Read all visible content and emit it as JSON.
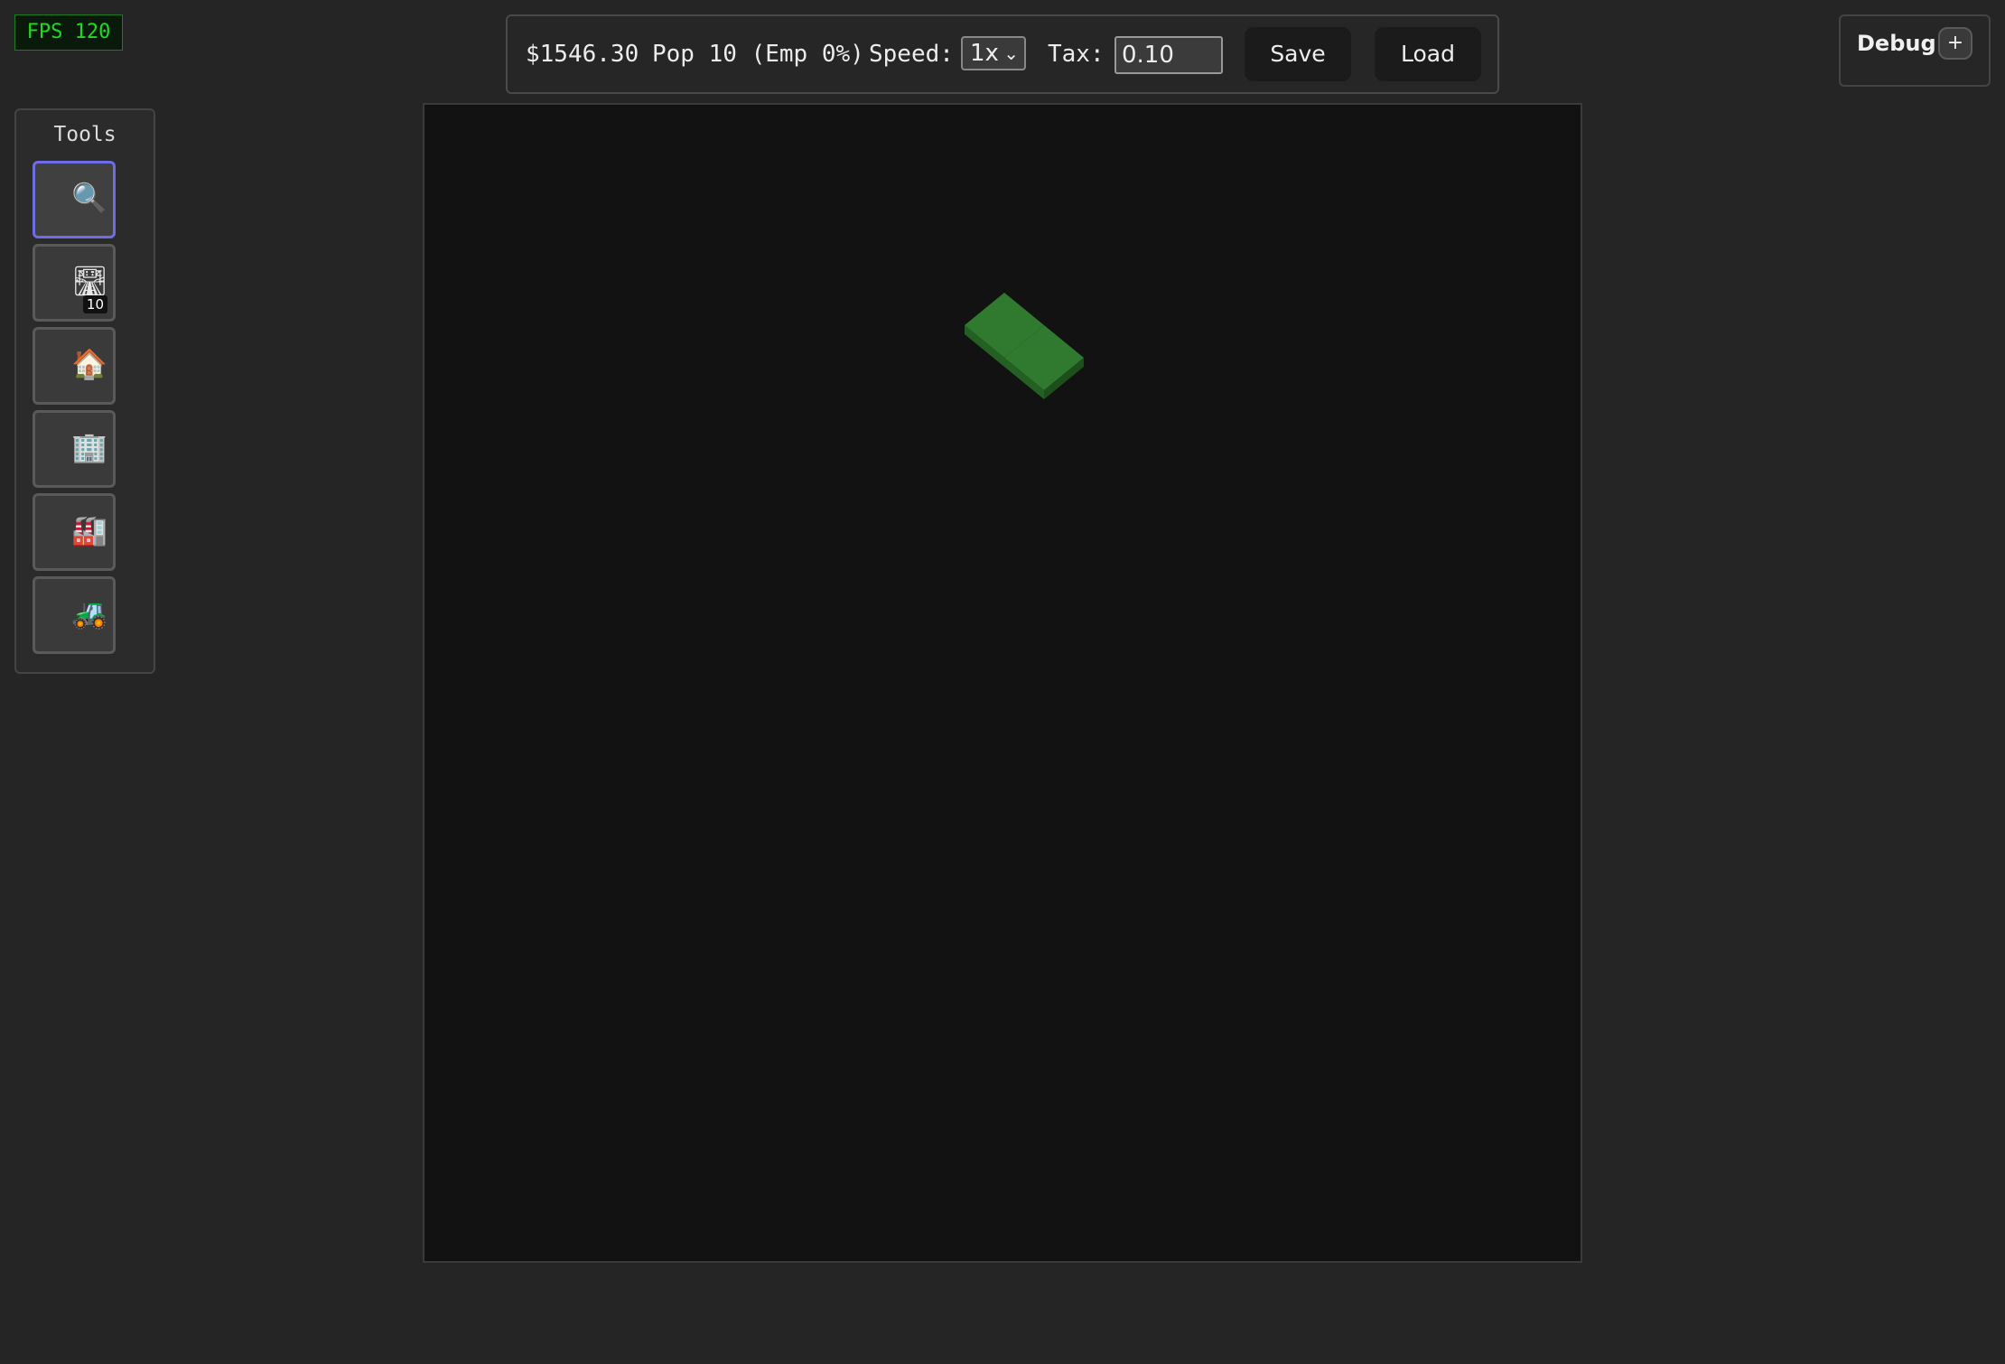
{
  "fps": {
    "label": "FPS 120"
  },
  "toolbar": {
    "money": "$1546.30",
    "population": "Pop 10 (Emp 0%)",
    "speed_label": "Speed:",
    "speed_value": "1x",
    "tax_label": "Tax:",
    "tax_value": "0.10",
    "save_label": "Save",
    "load_label": "Load"
  },
  "tools": {
    "title": "Tools",
    "items": [
      {
        "icon": "magnifier-icon",
        "glyph": "🔍",
        "active": true
      },
      {
        "icon": "road-icon",
        "glyph": "🛣",
        "badge": "10",
        "active": false
      },
      {
        "icon": "house-icon",
        "glyph": "🏠",
        "active": false
      },
      {
        "icon": "office-building-icon",
        "glyph": "🏢",
        "active": false
      },
      {
        "icon": "factory-icon",
        "glyph": "🏭",
        "active": false
      },
      {
        "icon": "tractor-icon",
        "glyph": "🚜",
        "active": false
      }
    ]
  },
  "debug": {
    "label": "Debug",
    "toggle": "+"
  },
  "map": {
    "tiles": [
      {
        "type": "grass",
        "color": "#2f7a2f"
      },
      {
        "type": "grass",
        "color": "#2f7a2f"
      }
    ]
  }
}
